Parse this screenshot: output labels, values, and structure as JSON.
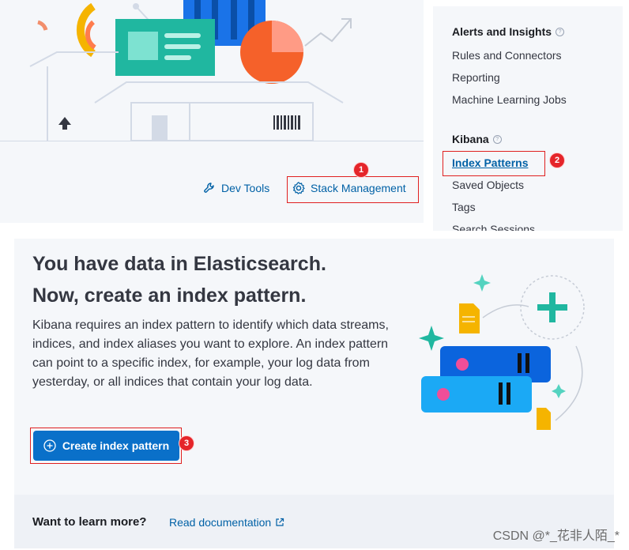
{
  "shortcuts": {
    "dev_tools": "Dev Tools",
    "stack_management": "Stack Management"
  },
  "nav": {
    "sections": [
      {
        "title": "Alerts and Insights",
        "items": [
          "Rules and Connectors",
          "Reporting",
          "Machine Learning Jobs"
        ]
      },
      {
        "title": "Kibana",
        "items": [
          "Index Patterns",
          "Saved Objects",
          "Tags",
          "Search Sessions"
        ]
      }
    ],
    "active_item": "Index Patterns",
    "help_icon": "?"
  },
  "main": {
    "title_line1": "You have data in Elasticsearch.",
    "title_line2": "Now, create an index pattern.",
    "description": "Kibana requires an index pattern to identify which data streams, indices, and index aliases you want to explore. An index pattern can point to a specific index, for example, your log data from yesterday, or all indices that contain your log data.",
    "create_button": "Create index pattern"
  },
  "footer": {
    "question": "Want to learn more?",
    "link": "Read documentation"
  },
  "annotations": [
    "1",
    "2",
    "3"
  ],
  "watermark": "CSDN @*_花非人陌_*",
  "colors": {
    "link": "#0061a6",
    "primary_button": "#0a70c9",
    "annotation_red": "#e5252a",
    "panel_bg": "#f5f7fa"
  }
}
